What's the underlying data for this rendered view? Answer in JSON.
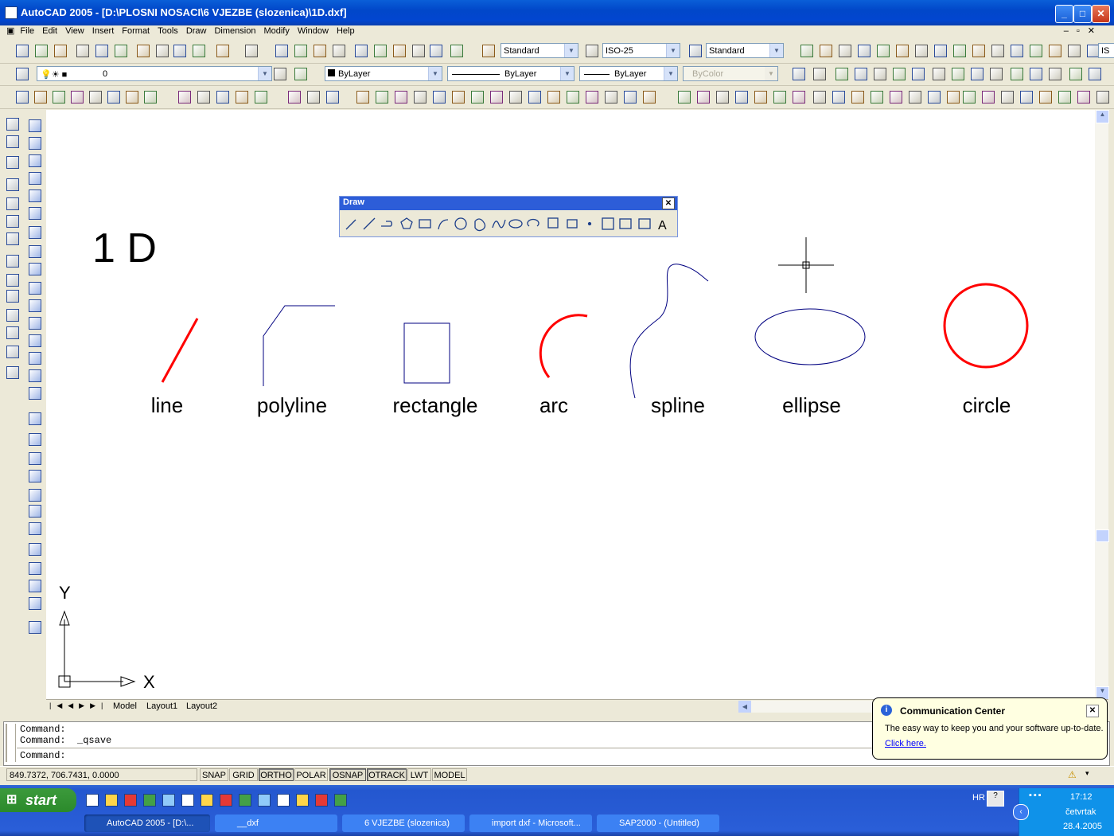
{
  "window": {
    "title": "AutoCAD 2005 - [D:\\PLOSNI  NOSACI\\6 VJEZBE (slozenica)\\1D.dxf]",
    "minimize": "_",
    "maximize": "□",
    "close": "✕"
  },
  "menu": [
    "File",
    "Edit",
    "View",
    "Insert",
    "Format",
    "Tools",
    "Draw",
    "Dimension",
    "Modify",
    "Window",
    "Help"
  ],
  "toolbars": {
    "text_style": "Standard",
    "dim_style": "ISO-25",
    "table_style": "Standard",
    "table_style_extra": "IS",
    "layer": "0",
    "color": "ByLayer",
    "linetype": "ByLayer",
    "lineweight": "ByLayer",
    "plot_style": "ByColor"
  },
  "draw_toolbar": {
    "title": "Draw",
    "text_tool": "A"
  },
  "drawing": {
    "heading": "1 D",
    "labels": {
      "line": "line",
      "polyline": "polyline",
      "rectangle": "rectangle",
      "arc": "arc",
      "spline": "spline",
      "ellipse": "ellipse",
      "circle": "circle"
    },
    "ucs_x": "X",
    "ucs_y": "Y",
    "red": "#ff0000",
    "blue": "#000080"
  },
  "tabs": [
    "Model",
    "Layout1",
    "Layout2"
  ],
  "command": {
    "line1": "Command:",
    "line2": "Command:  _qsave",
    "line3": "Command:"
  },
  "status": {
    "coords": "849.7372,  706.7431, 0.0000",
    "buttons": [
      "SNAP",
      "GRID",
      "ORTHO",
      "POLAR",
      "OSNAP",
      "OTRACK",
      "LWT",
      "MODEL"
    ]
  },
  "comm_center": {
    "title": "Communication Center",
    "text": "The easy way to keep you and your software up-to-date.",
    "link": "Click here."
  },
  "taskbar": {
    "start": "start",
    "tasks": [
      "AutoCAD 2005 - [D:\\...",
      "__dxf",
      "6 VJEZBE (slozenica)",
      "import dxf - Microsoft...",
      "SAP2000 - (Untitled)"
    ],
    "lang": "HR",
    "time": "17:12",
    "day": "četvrtak",
    "date": "28.4.2005"
  }
}
